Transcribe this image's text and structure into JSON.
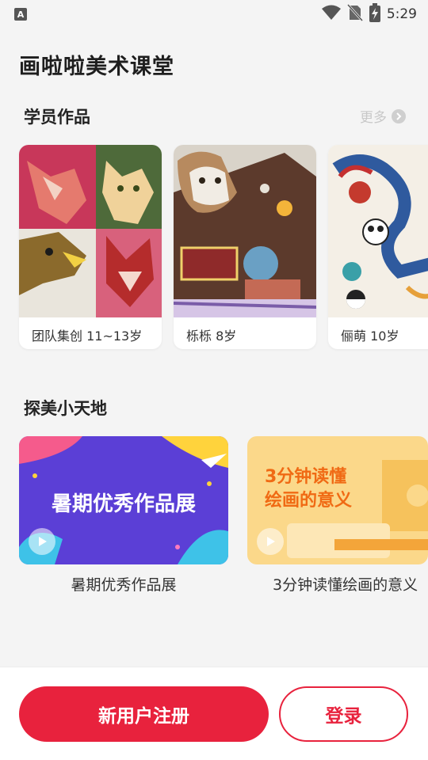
{
  "status_bar": {
    "time": "5:29",
    "notification_glyph": "A"
  },
  "app": {
    "title": "画啦啦美术课堂"
  },
  "student_works": {
    "title": "学员作品",
    "more_label": "更多",
    "items": [
      {
        "caption": "团队集创  11~13岁"
      },
      {
        "caption": "栎栎  8岁"
      },
      {
        "caption": "俪萌  10岁"
      }
    ]
  },
  "explore": {
    "title": "探美小天地",
    "items": [
      {
        "banner_text": "暑期优秀作品展",
        "caption": "暑期优秀作品展"
      },
      {
        "banner_line1": "3分钟读懂",
        "banner_line2": "绘画的意义",
        "caption": "3分钟读懂绘画的意义"
      }
    ]
  },
  "actions": {
    "register_label": "新用户注册",
    "login_label": "登录"
  },
  "colors": {
    "brand_red": "#e8223d",
    "background": "#f4f4f4"
  }
}
